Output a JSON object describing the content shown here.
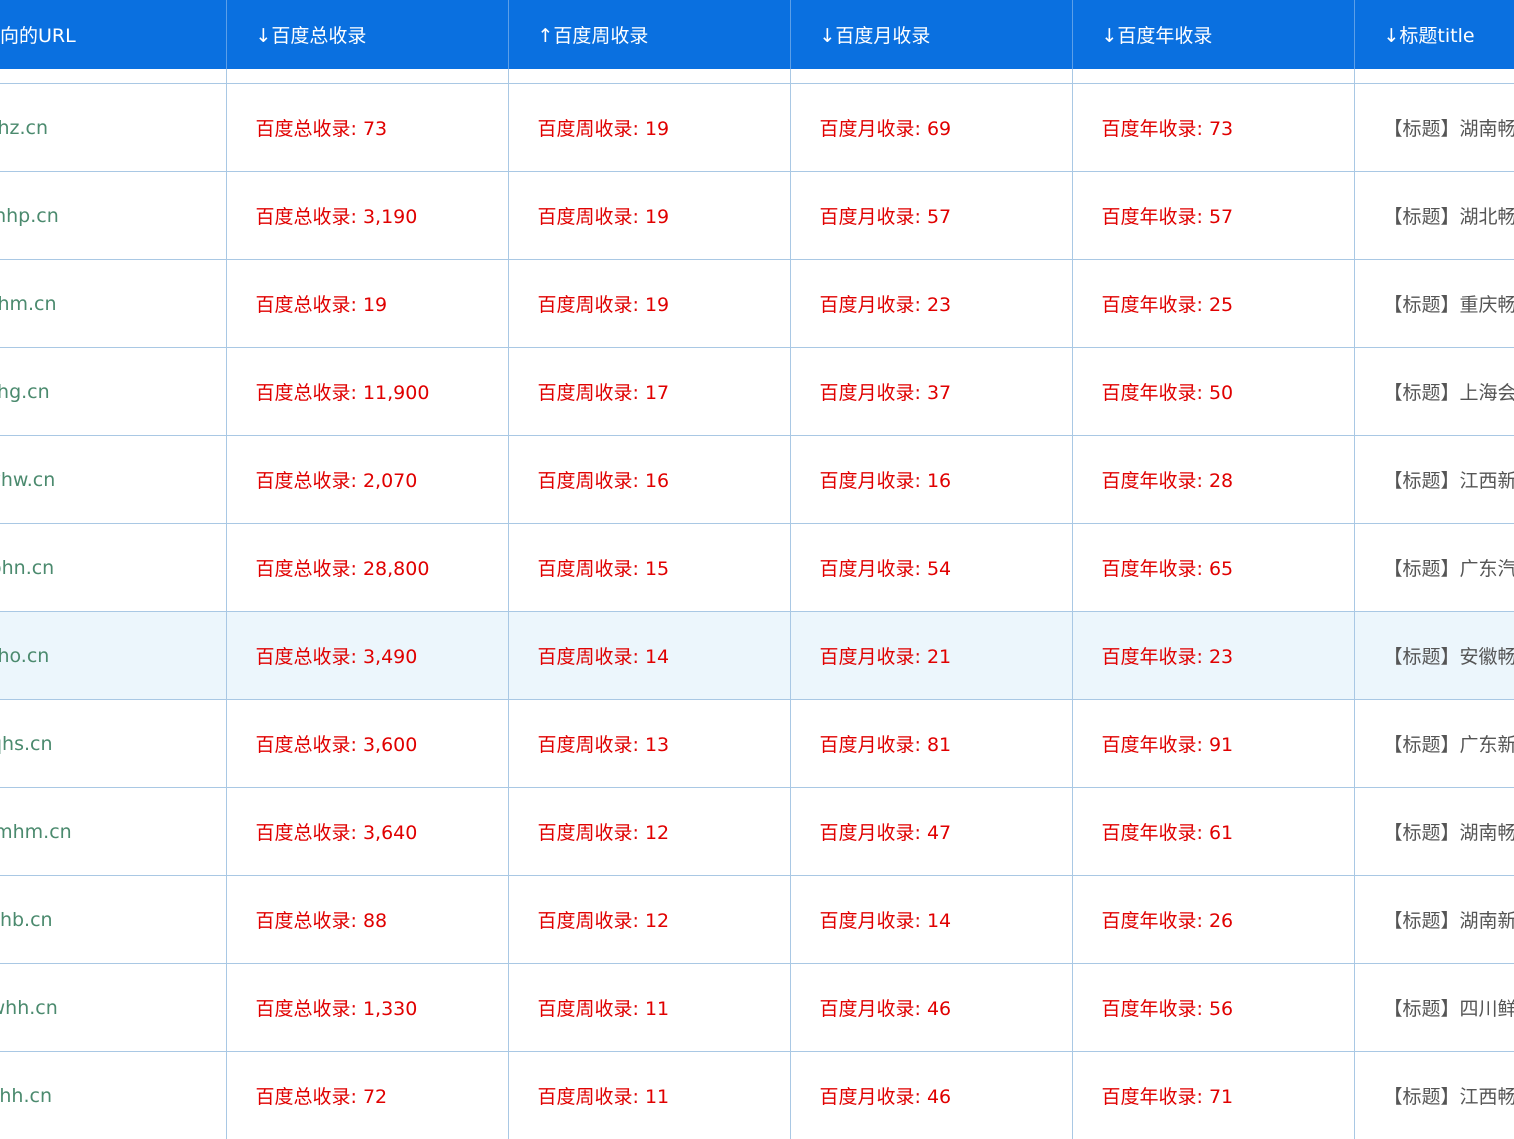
{
  "header": {
    "columns": [
      "向的URL",
      "↓百度总收录",
      "↑百度周收录",
      "↓百度月收录",
      "↓百度年收录",
      "↓标题title"
    ]
  },
  "rows": [
    {
      "url": "w.jbrgfnhz.cn",
      "total": "百度总收录: 73",
      "week": "百度周收录: 19",
      "month": "百度月收录: 69",
      "year": "百度年收录: 73",
      "title": "【标题】湖南畅"
    },
    {
      "url": "w.kbcgfhhp.cn",
      "total": "百度总收录: 3,190",
      "week": "百度周收录: 19",
      "month": "百度月收录: 57",
      "year": "百度年收录: 57",
      "title": "【标题】湖北畅"
    },
    {
      "url": "w.jbrgfnhm.cn",
      "total": "百度总收录: 19",
      "week": "百度周收录: 19",
      "month": "百度月收录: 23",
      "year": "百度年收录: 25",
      "title": "【标题】重庆畅"
    },
    {
      "url": "w.jbrgfohg.cn",
      "total": "百度总收录: 11,900",
      "week": "百度周收录: 17",
      "month": "百度月收录: 37",
      "year": "百度年收录: 50",
      "title": "【标题】上海会"
    },
    {
      "url": "w.jbqgfyhw.cn",
      "total": "百度总收录: 2,070",
      "week": "百度周收录: 16",
      "month": "百度月收录: 16",
      "year": "百度年收录: 28",
      "title": "【标题】江西新"
    },
    {
      "url": "w.jbqgfohn.cn",
      "total": "百度总收录: 28,800",
      "week": "百度周收录: 15",
      "month": "百度月收录: 54",
      "year": "百度年收录: 65",
      "title": "【标题】广东汽"
    },
    {
      "url": "w.jbrgfnho.cn",
      "total": "百度总收录: 3,490",
      "week": "百度周收录: 14",
      "month": "百度月收录: 21",
      "year": "百度年收录: 23",
      "title": "【标题】安徽畅",
      "highlight": true
    },
    {
      "url": "w.jbqgfqhs.cn",
      "total": "百度总收录: 3,600",
      "week": "百度周收录: 13",
      "month": "百度月收录: 81",
      "year": "百度年收录: 91",
      "title": "【标题】广东新"
    },
    {
      "url": "w.kbcgfmhm.cn",
      "total": "百度总收录: 3,640",
      "week": "百度周收录: 12",
      "month": "百度月收录: 47",
      "year": "百度年收录: 61",
      "title": "【标题】湖南畅"
    },
    {
      "url": "w.jbqgfzhb.cn",
      "total": "百度总收录: 88",
      "week": "百度周收录: 12",
      "month": "百度月收录: 14",
      "year": "百度年收录: 26",
      "title": "【标题】湖南新"
    },
    {
      "url": "w.jbugfwhh.cn",
      "total": "百度总收录: 1,330",
      "week": "百度周收录: 11",
      "month": "百度月收录: 46",
      "year": "百度年收录: 56",
      "title": "【标题】四川鲜"
    },
    {
      "url": "w.kbcgfjhh.cn",
      "total": "百度总收录: 72",
      "week": "百度周收录: 11",
      "month": "百度月收录: 46",
      "year": "百度年收录: 71",
      "title": "【标题】江西畅"
    }
  ]
}
